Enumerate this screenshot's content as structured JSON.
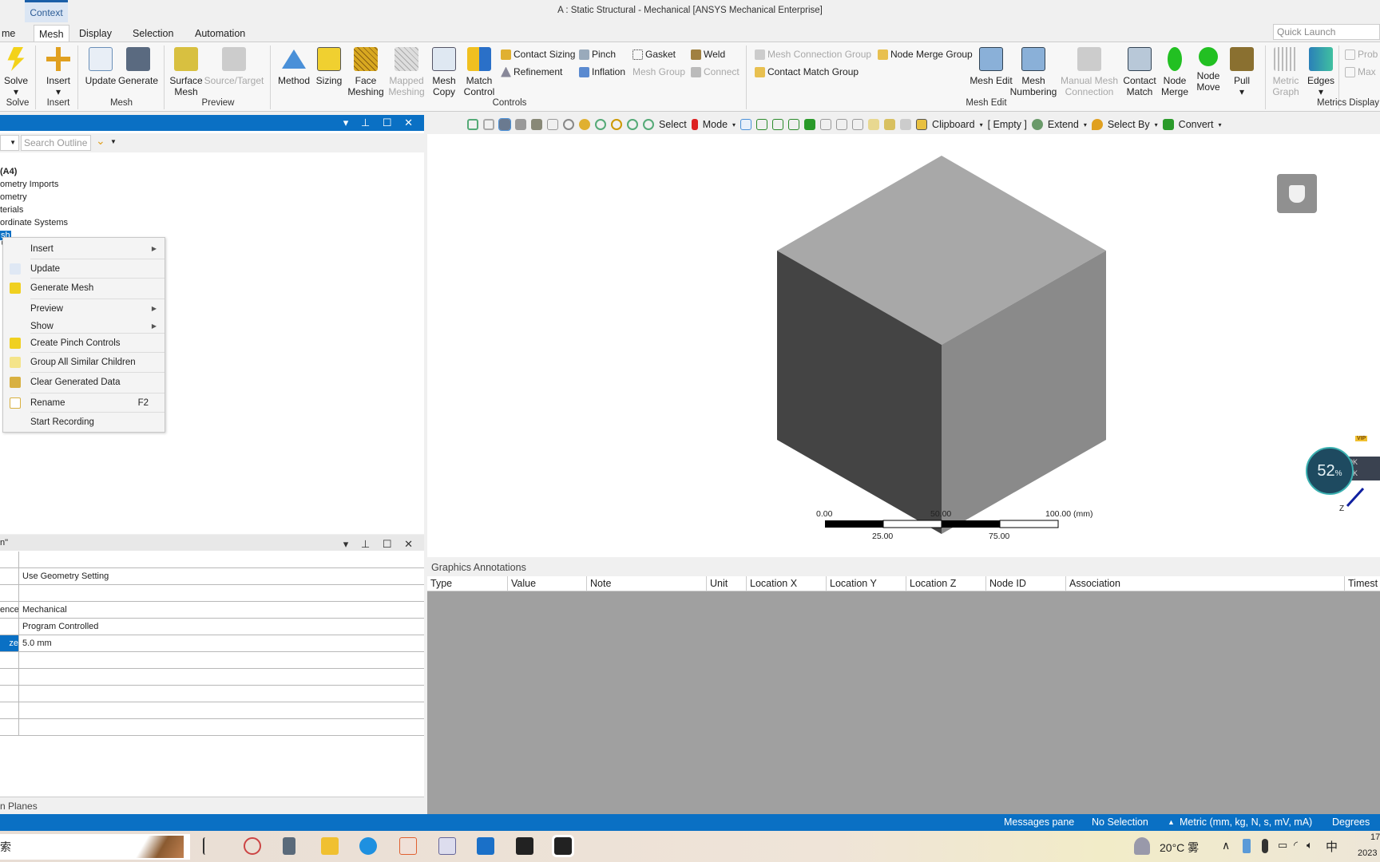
{
  "window": {
    "title": "A : Static Structural - Mechanical [ANSYS Mechanical Enterprise]",
    "context_tab": "Context"
  },
  "ribbon_tabs": [
    "me",
    "Mesh",
    "Display",
    "Selection",
    "Automation"
  ],
  "quick_launch_placeholder": "Quick Launch",
  "ribbon": {
    "solve": "Solve",
    "insert": "Insert",
    "update": "Update",
    "generate": "Generate",
    "surface_mesh": "Surface Mesh",
    "source_target": "Source/Target",
    "method": "Method",
    "sizing": "Sizing",
    "face_meshing": "Face Meshing",
    "mapped_meshing": "Mapped Meshing",
    "mesh_copy": "Mesh Copy",
    "match_control": "Match Control",
    "contact_sizing": "Contact Sizing",
    "refinement": "Refinement",
    "pinch": "Pinch",
    "inflation": "Inflation",
    "gasket": "Gasket",
    "mesh_group": "Mesh Group",
    "weld": "Weld",
    "connect": "Connect",
    "mesh_connection_group": "Mesh Connection Group",
    "contact_match_group": "Contact Match Group",
    "node_merge_group": "Node Merge Group",
    "mesh_edit": "Mesh Edit",
    "mesh_numbering": "Mesh Numbering",
    "manual_mesh_connection": "Manual Mesh Connection",
    "contact_match": "Contact Match",
    "node_merge": "Node Merge",
    "node_move": "Node Move",
    "pull": "Pull",
    "metric_graph": "Metric Graph",
    "edges": "Edges",
    "probe": "Prob",
    "max": "Max",
    "groups": {
      "solve": "Solve",
      "insert": "Insert",
      "mesh": "Mesh",
      "preview": "Preview",
      "controls": "Controls",
      "mesh_edit": "Mesh Edit",
      "metrics_display": "Metrics Display"
    }
  },
  "outline": {
    "search_placeholder": "Search Outline",
    "tree": [
      "(A4)",
      "ometry Imports",
      "ometry",
      "terials",
      "ordinate Systems",
      "sh"
    ]
  },
  "context_menu": [
    {
      "label": "Insert",
      "submenu": true
    },
    {
      "label": "Update",
      "icon": "update-icon"
    },
    {
      "label": "Generate Mesh",
      "icon": "lightning-icon"
    },
    {
      "label": "Preview",
      "submenu": true
    },
    {
      "label": "Show",
      "submenu": true
    },
    {
      "label": "Create Pinch Controls",
      "icon": "lightning-icon"
    },
    {
      "label": "Group All Similar Children",
      "icon": "folder-icon"
    },
    {
      "label": "Clear Generated Data",
      "icon": "eraser-icon"
    },
    {
      "label": "Rename",
      "icon": "rename-icon",
      "shortcut": "F2"
    },
    {
      "label": "Start Recording"
    }
  ],
  "details": {
    "title": "n\"",
    "rows": [
      {
        "k": "",
        "v": ""
      },
      {
        "k": "",
        "v": "Use Geometry Setting"
      },
      {
        "k": "",
        "v": ""
      },
      {
        "k": "ence",
        "v": "Mechanical"
      },
      {
        "k": "",
        "v": "Program Controlled"
      },
      {
        "k": "ze",
        "v": "5.0 mm",
        "selected": true
      }
    ],
    "footer": "n Planes"
  },
  "viewport_toolbar": {
    "select": "Select",
    "mode": "Mode",
    "clipboard": "Clipboard",
    "empty": "[ Empty ]",
    "extend": "Extend",
    "select_by": "Select By",
    "convert": "Convert"
  },
  "scale_bar": {
    "top": [
      "0.00",
      "50.00",
      "100.00 (mm)"
    ],
    "bottom": [
      "25.00",
      "75.00"
    ]
  },
  "triad_label": "Z",
  "net_widget": {
    "percent": "52",
    "unit": "%",
    "up": "0K",
    "down": "0K",
    "badge": "VIP"
  },
  "annotations": {
    "title": "Graphics Annotations",
    "columns": [
      "Type",
      "Value",
      "Note",
      "Unit",
      "Location X",
      "Location Y",
      "Location Z",
      "Node ID",
      "Association",
      "Timest"
    ]
  },
  "status": {
    "messages": "Messages pane",
    "selection": "No Selection",
    "units": "Metric (mm, kg, N, s, mV, mA)",
    "angle": "Degrees"
  },
  "taskbar": {
    "search": "索",
    "weather": "20°C 雾",
    "ime": "中",
    "time": "17",
    "date": "2023"
  },
  "colors": {
    "accent": "#0a70c4",
    "cube_top": "#a8a8a8",
    "cube_left": "#444444",
    "cube_right": "#8a8a8a"
  }
}
